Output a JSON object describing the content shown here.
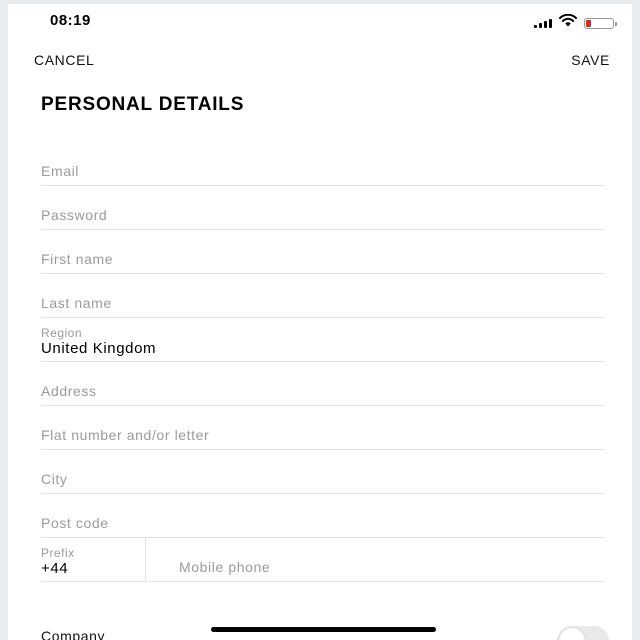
{
  "status_bar": {
    "time": "08:19",
    "battery_color": "#e0261c",
    "icons": [
      "signal-icon",
      "wifi-icon",
      "battery-icon"
    ]
  },
  "nav": {
    "cancel_label": "CANCEL",
    "save_label": "SAVE"
  },
  "page_title": "PERSONAL DETAILS",
  "form": {
    "email": {
      "placeholder": "Email",
      "value": ""
    },
    "password": {
      "placeholder": "Password",
      "value": ""
    },
    "first_name": {
      "placeholder": "First name",
      "value": ""
    },
    "last_name": {
      "placeholder": "Last name",
      "value": ""
    },
    "region": {
      "label": "Region",
      "value": "United Kingdom"
    },
    "address": {
      "placeholder": "Address",
      "value": ""
    },
    "flat": {
      "placeholder": "Flat number and/or letter",
      "value": ""
    },
    "city": {
      "placeholder": "City",
      "value": ""
    },
    "post_code": {
      "placeholder": "Post code",
      "value": ""
    },
    "prefix": {
      "label": "Prefix",
      "value": "+44"
    },
    "mobile_phone": {
      "placeholder": "Mobile phone",
      "value": ""
    }
  },
  "company": {
    "label": "Company",
    "toggle_on": false
  }
}
